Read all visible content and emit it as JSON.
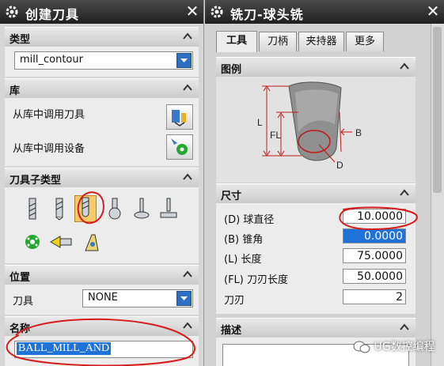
{
  "left_dialog": {
    "title": "创建刀具",
    "sections": {
      "type": {
        "header": "类型",
        "combo_value": "mill_contour"
      },
      "library": {
        "header": "库",
        "retrieve_tool": "从库中调用刀具",
        "retrieve_device": "从库中调用设备"
      },
      "subtype": {
        "header": "刀具子类型"
      },
      "location": {
        "header": "位置",
        "tool_label": "刀具",
        "tool_value": "NONE"
      },
      "name": {
        "header": "名称",
        "value": "BALL_MILL_AND"
      }
    }
  },
  "right_dialog": {
    "title": "铣刀-球头铣",
    "tabs": [
      {
        "label": "工具"
      },
      {
        "label": "刀柄"
      },
      {
        "label": "夹持器"
      },
      {
        "label": "更多"
      }
    ],
    "legend": {
      "header": "图例",
      "labels": {
        "L": "L",
        "FL": "FL",
        "B": "B",
        "D": "D"
      }
    },
    "dimensions": {
      "header": "尺寸",
      "rows": [
        {
          "label": "(D) 球直径",
          "value": "10.0000"
        },
        {
          "label": "(B) 锥角",
          "value": "0.0000"
        },
        {
          "label": "(L) 长度",
          "value": "75.0000"
        },
        {
          "label": "(FL) 刀刃长度",
          "value": "50.0000"
        },
        {
          "label": "刀刃",
          "value": "2"
        }
      ]
    },
    "description": {
      "header": "描述"
    }
  },
  "watermark": "UG数控编程",
  "colors": {
    "titlebar": "#2a2a2a",
    "accent": "#2d6fc3",
    "annotation": "#d81b1b"
  }
}
